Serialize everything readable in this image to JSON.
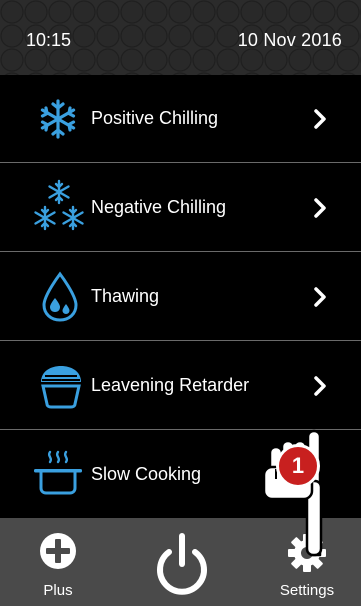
{
  "status": {
    "time": "10:15",
    "date": "10 Nov 2016"
  },
  "menu": {
    "items": [
      {
        "label": "Positive Chilling",
        "icon": "snowflake-icon",
        "has_chevron": true
      },
      {
        "label": "Negative Chilling",
        "icon": "snowflakes-icon",
        "has_chevron": true
      },
      {
        "label": "Thawing",
        "icon": "water-drop-icon",
        "has_chevron": true
      },
      {
        "label": "Leavening Retarder",
        "icon": "bread-icon",
        "has_chevron": true
      },
      {
        "label": "Slow Cooking",
        "icon": "cooking-pot-icon",
        "has_chevron": false
      }
    ]
  },
  "bottom_bar": {
    "plus_label": "Plus",
    "settings_label": "Settings"
  },
  "annotation": {
    "step_number": "1"
  },
  "colors": {
    "accent_blue": "#3aa0e0",
    "bottom_bar": "#4a4a4a",
    "badge_red": "#c8201f",
    "divider": "#6a6a6a"
  }
}
